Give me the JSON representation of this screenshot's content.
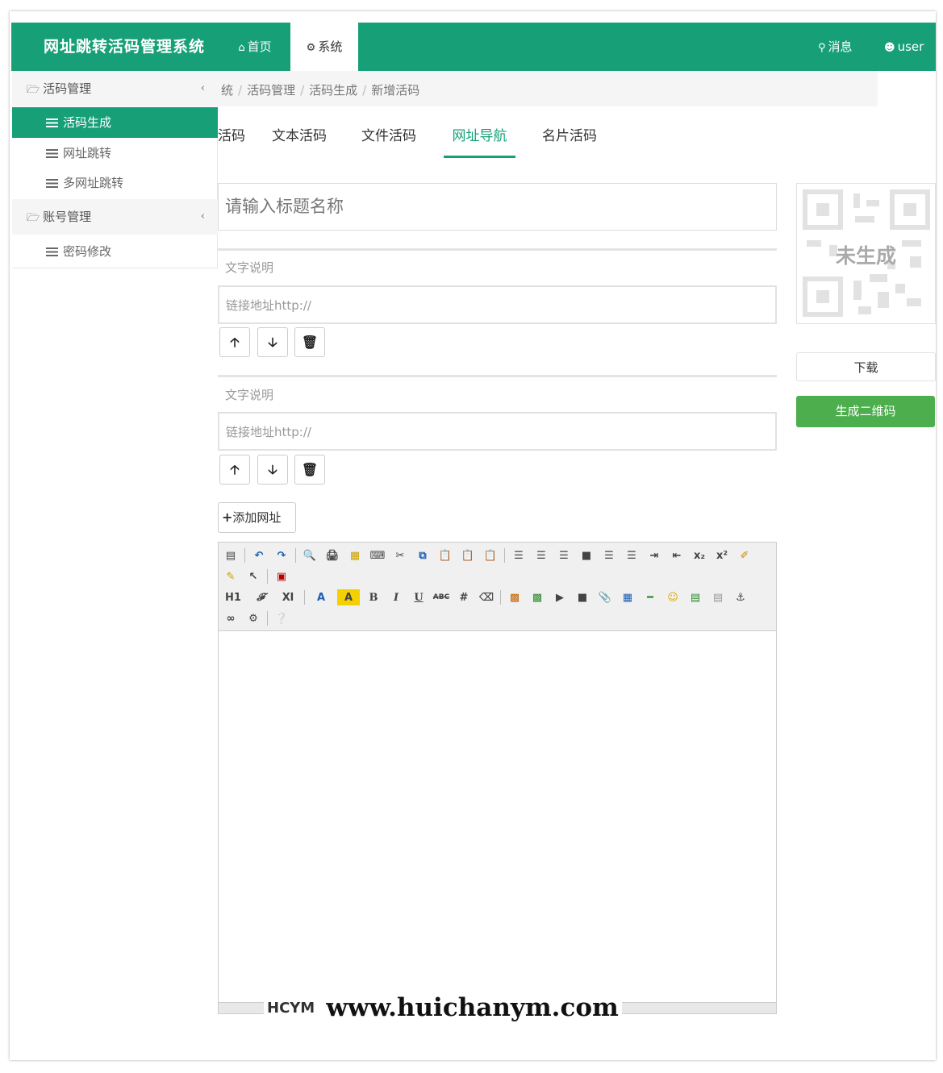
{
  "header": {
    "brand": "网址跳转活码管理系统",
    "nav_home": "首页",
    "nav_system": "系统",
    "nav_message": "消息",
    "nav_user": "user",
    "color": "#17a078"
  },
  "sidebar": {
    "groups": [
      {
        "label": "活码管理",
        "items": [
          "活码生成",
          "网址跳转",
          "多网址跳转"
        ]
      },
      {
        "label": "账号管理",
        "items": [
          "密码修改"
        ]
      }
    ],
    "active_item": "活码生成"
  },
  "breadcrumb": {
    "items": [
      "统",
      "活码管理",
      "活码生成",
      "新增活码"
    ],
    "separator": "/"
  },
  "tabs": {
    "items": [
      "活码",
      "文本活码",
      "文件活码",
      "网址导航",
      "名片活码"
    ],
    "active": "网址导航"
  },
  "form": {
    "title_placeholder": "请输入标题名称",
    "links": [
      {
        "text_placeholder": "文字说明",
        "url_placeholder": "链接地址http://"
      },
      {
        "text_placeholder": "文字说明",
        "url_placeholder": "链接地址http://"
      }
    ],
    "add_button": "添加网址"
  },
  "editor": {
    "toolbar_labels": {
      "h1": "H1",
      "b": "B",
      "i": "I",
      "u": "U",
      "abc": "ABC",
      "sub": "x₂",
      "sup": "x²",
      "font_a": "A"
    }
  },
  "qr": {
    "status": "未生成",
    "download_label": "下载",
    "generate_label": "生成二维码",
    "generate_color": "#4cae4c"
  },
  "watermark": {
    "logo": "HCYM",
    "url": "www.huichanym.com"
  }
}
